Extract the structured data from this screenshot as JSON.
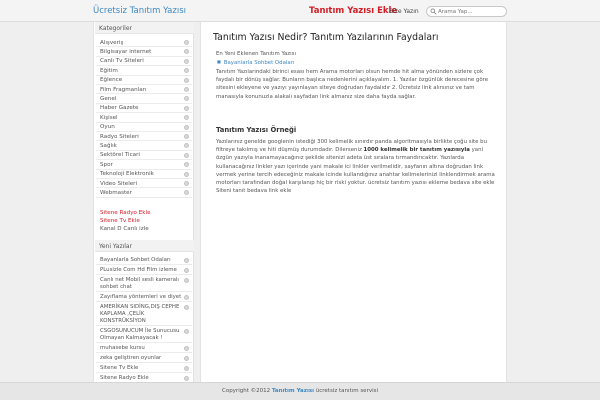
{
  "header": {
    "site_title": "Ücretsiz Tanıtım Yazısı",
    "nav_main": "Tanıtım Yazısı Ekle",
    "nav_contact": "Bize Yazın",
    "search_placeholder": "Arama Yap..."
  },
  "sidebar": {
    "categories_heading": "Kategoriler",
    "categories": [
      "Alışveriş",
      "Bilgisayar internet",
      "Canlı Tv Siteleri",
      "Eğitim",
      "Eğlence",
      "Film Fragmanları",
      "Genel",
      "Haber Gazete",
      "Kişisel",
      "Oyun",
      "Radyo Siteleri",
      "Sağlık",
      "Sektörel Ticari",
      "Spor",
      "Teknoloji Elektronik",
      "Video Siteleri",
      "Webmaster"
    ],
    "extra_links": [
      "Sitene Radyo Ekle",
      "Sitene Tv Ekle",
      "Kanal D Canlı izle"
    ],
    "recent_heading": "Yeni Yazılar",
    "recent_posts": [
      "Bayanlarla Sohbet Odaları",
      "PLusizle Com Hd Film izleme Sitesi",
      "Canlı net Mobil sesli kameralı sohbet chat",
      "Zayıflama yöntemleri ve diyet",
      "AMERİKAN SIDİNG,DIŞ CEPHE KAPLAMA ,ÇELİK KONSTRÜKSİYON",
      "CSGOSUNUCUM İle Sunucusu Olmayan Kalmayacak !",
      "muhasebe kursu",
      "zeka geliştiren oyunlar",
      "Sitene Tv Ekle",
      "Sitene Radyo Ekle"
    ]
  },
  "article": {
    "title": "Tanıtım Yazısı Nedir? Tanıtım Yazılarının Faydaları",
    "latest_label": "En Yeni Eklenen Tanıtım Yazısı",
    "latest_link": "Bayanlarla Sohbet Odaları",
    "paragraph_1": "Tanıtım Yazılarındaki birinci esası hem Arama motorları olsun hemde hit alma yönünden sizlere çok faydalı bir dönüş sağlar. Bunların başlıca nedenlerini açıklayalım.   1. Yazılar özgünlük derecesine göre sitesini ekleyene ve yazıyı yayınlayan siteye doğrudan faydalıdır 2. Ücretsiz link alırsınız ve tam manasıyla konunuzla alakalı sayfadan link almanız size daha fayda sağlar.",
    "subheading": "Tanıtım Yazısı Örneği",
    "p2_before": "Yazılarınız genelde googlenin istediği 300 kelimelik sınırdır panda algoritmasıyla birlikte çoğu site bu filtreye takılmış ve hiti düşmüş durumdadır. Dilerseniz ",
    "p2_bold": "1000 kelimelik bir tanıtım yazısıyla",
    "p2_after": " yani özgün yazıyla inanamayacağınız şekilde sitenizi adeta üst sıralara tırmandırıcaktır. Yazılarda kullanacağınız linkler yazı içerinde yani makale ici linkler verilmelidir, sayfanın altına doğrudan link vermek yerine tercih edeceğiniz makale icinde kullandığınız anahtar kelimelerinizi linklendirmek arama motorları tarafından doğal karşılanıp hiç bir riski yoktur.    ücretsiz tanıtım yazısı ekleme bedava site ekle Siteni tanıt bedava link ekle"
  },
  "footer": {
    "copyright": "Copyright ©2012",
    "brand": "Tanıtım Yazısı",
    "tagline": "ücretsiz tanıtım servisi"
  },
  "colors": {
    "accent_blue": "#3f88c5",
    "accent_red": "#d11e26"
  }
}
